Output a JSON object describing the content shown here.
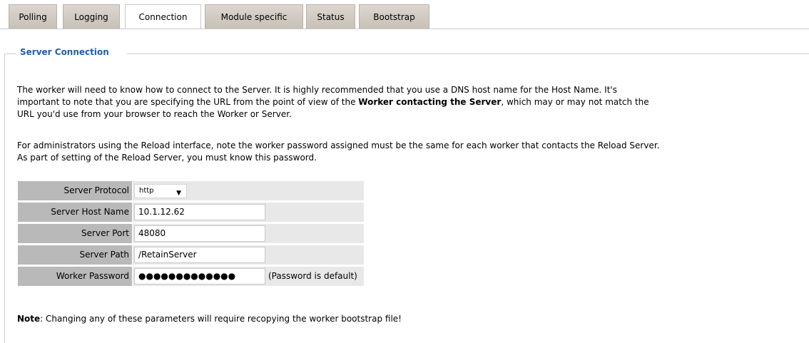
{
  "tabs": [
    {
      "label": "Polling"
    },
    {
      "label": "Logging"
    },
    {
      "label": "Connection"
    },
    {
      "label": "Module specific"
    },
    {
      "label": "Status"
    },
    {
      "label": "Bootstrap"
    }
  ],
  "section": {
    "title": "Server Connection",
    "para1": {
      "text_a": "The worker will need to know how to connect to the Server. It is highly recommended that you use a DNS host name for the Host Name. It's",
      "text_b": "important to note that you are specifying the URL from the point of view of the ",
      "bold": "Worker contacting the Server",
      "text_c": ", which may or may not match the",
      "text_d": "URL you'd use from your browser to reach the Worker or Server."
    },
    "para2": {
      "line1": "For administrators using the Reload interface, note the worker password assigned must be the same for each worker that contacts the Reload Server.",
      "line2": "As part of setting of the Reload Server, you must know this password."
    }
  },
  "form": {
    "protocol": {
      "label": "Server Protocol",
      "value": "http"
    },
    "host": {
      "label": "Server Host Name",
      "value": "10.1.12.62"
    },
    "port": {
      "label": "Server Port",
      "value": "48080"
    },
    "path": {
      "label": "Server Path",
      "value": "/RetainServer"
    },
    "password": {
      "label": "Worker Password",
      "value": "●●●●●●●●●●●●●",
      "hint": "(Password is default)"
    }
  },
  "note": {
    "bold": "Note",
    "text": ": Changing any of these parameters will require recopying the worker bootstrap file!"
  }
}
